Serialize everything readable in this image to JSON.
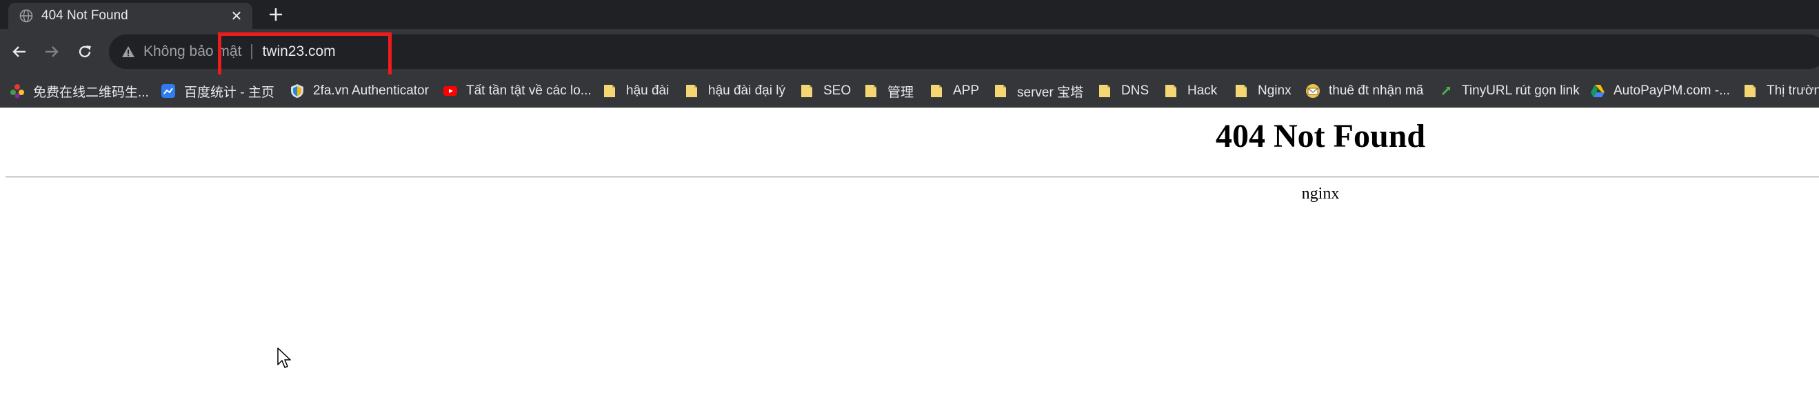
{
  "browser": {
    "tab": {
      "title": "404 Not Found",
      "close_glyph": "✕",
      "favicon": "globe-icon"
    },
    "new_tab_icon": "plus-icon",
    "toolbar": {
      "back_icon": "arrow-left-icon",
      "forward_icon": "arrow-right-icon",
      "reload_icon": "reload-icon"
    },
    "omnibox": {
      "security_icon": "warning-triangle-icon",
      "security_label": "Không bảo mật",
      "url": "twin23.com"
    },
    "highlight_color": "#ee1c1c",
    "bookmarks": [
      {
        "label": "免费在线二维码生...",
        "icon": "colorful-dots-icon"
      },
      {
        "label": "百度统计 - 主页",
        "icon": "baidu-stats-icon"
      },
      {
        "label": "2fa.vn Authenticator",
        "icon": "shield-icon"
      },
      {
        "label": "Tất tần tật về các lo...",
        "icon": "youtube-icon"
      },
      {
        "label": "hậu đài",
        "icon": "folder-icon"
      },
      {
        "label": "hậu đài đại lý",
        "icon": "folder-icon"
      },
      {
        "label": "SEO",
        "icon": "folder-icon"
      },
      {
        "label": "管理",
        "icon": "folder-icon"
      },
      {
        "label": "APP",
        "icon": "folder-icon"
      },
      {
        "label": "server 宝塔",
        "icon": "folder-icon"
      },
      {
        "label": "DNS",
        "icon": "folder-icon"
      },
      {
        "label": "Hack",
        "icon": "folder-icon"
      },
      {
        "label": "Nginx",
        "icon": "folder-icon"
      },
      {
        "label": "thuê đt nhận mã",
        "icon": "envelope-icon"
      },
      {
        "label": "TinyURL rút gọn link",
        "icon": "tinyurl-icon"
      },
      {
        "label": "AutoPayPM.com -...",
        "icon": "google-drive-icon"
      },
      {
        "label": "Thị trường",
        "icon": "folder-icon"
      }
    ]
  },
  "page": {
    "heading": "404 Not Found",
    "server": "nginx"
  }
}
